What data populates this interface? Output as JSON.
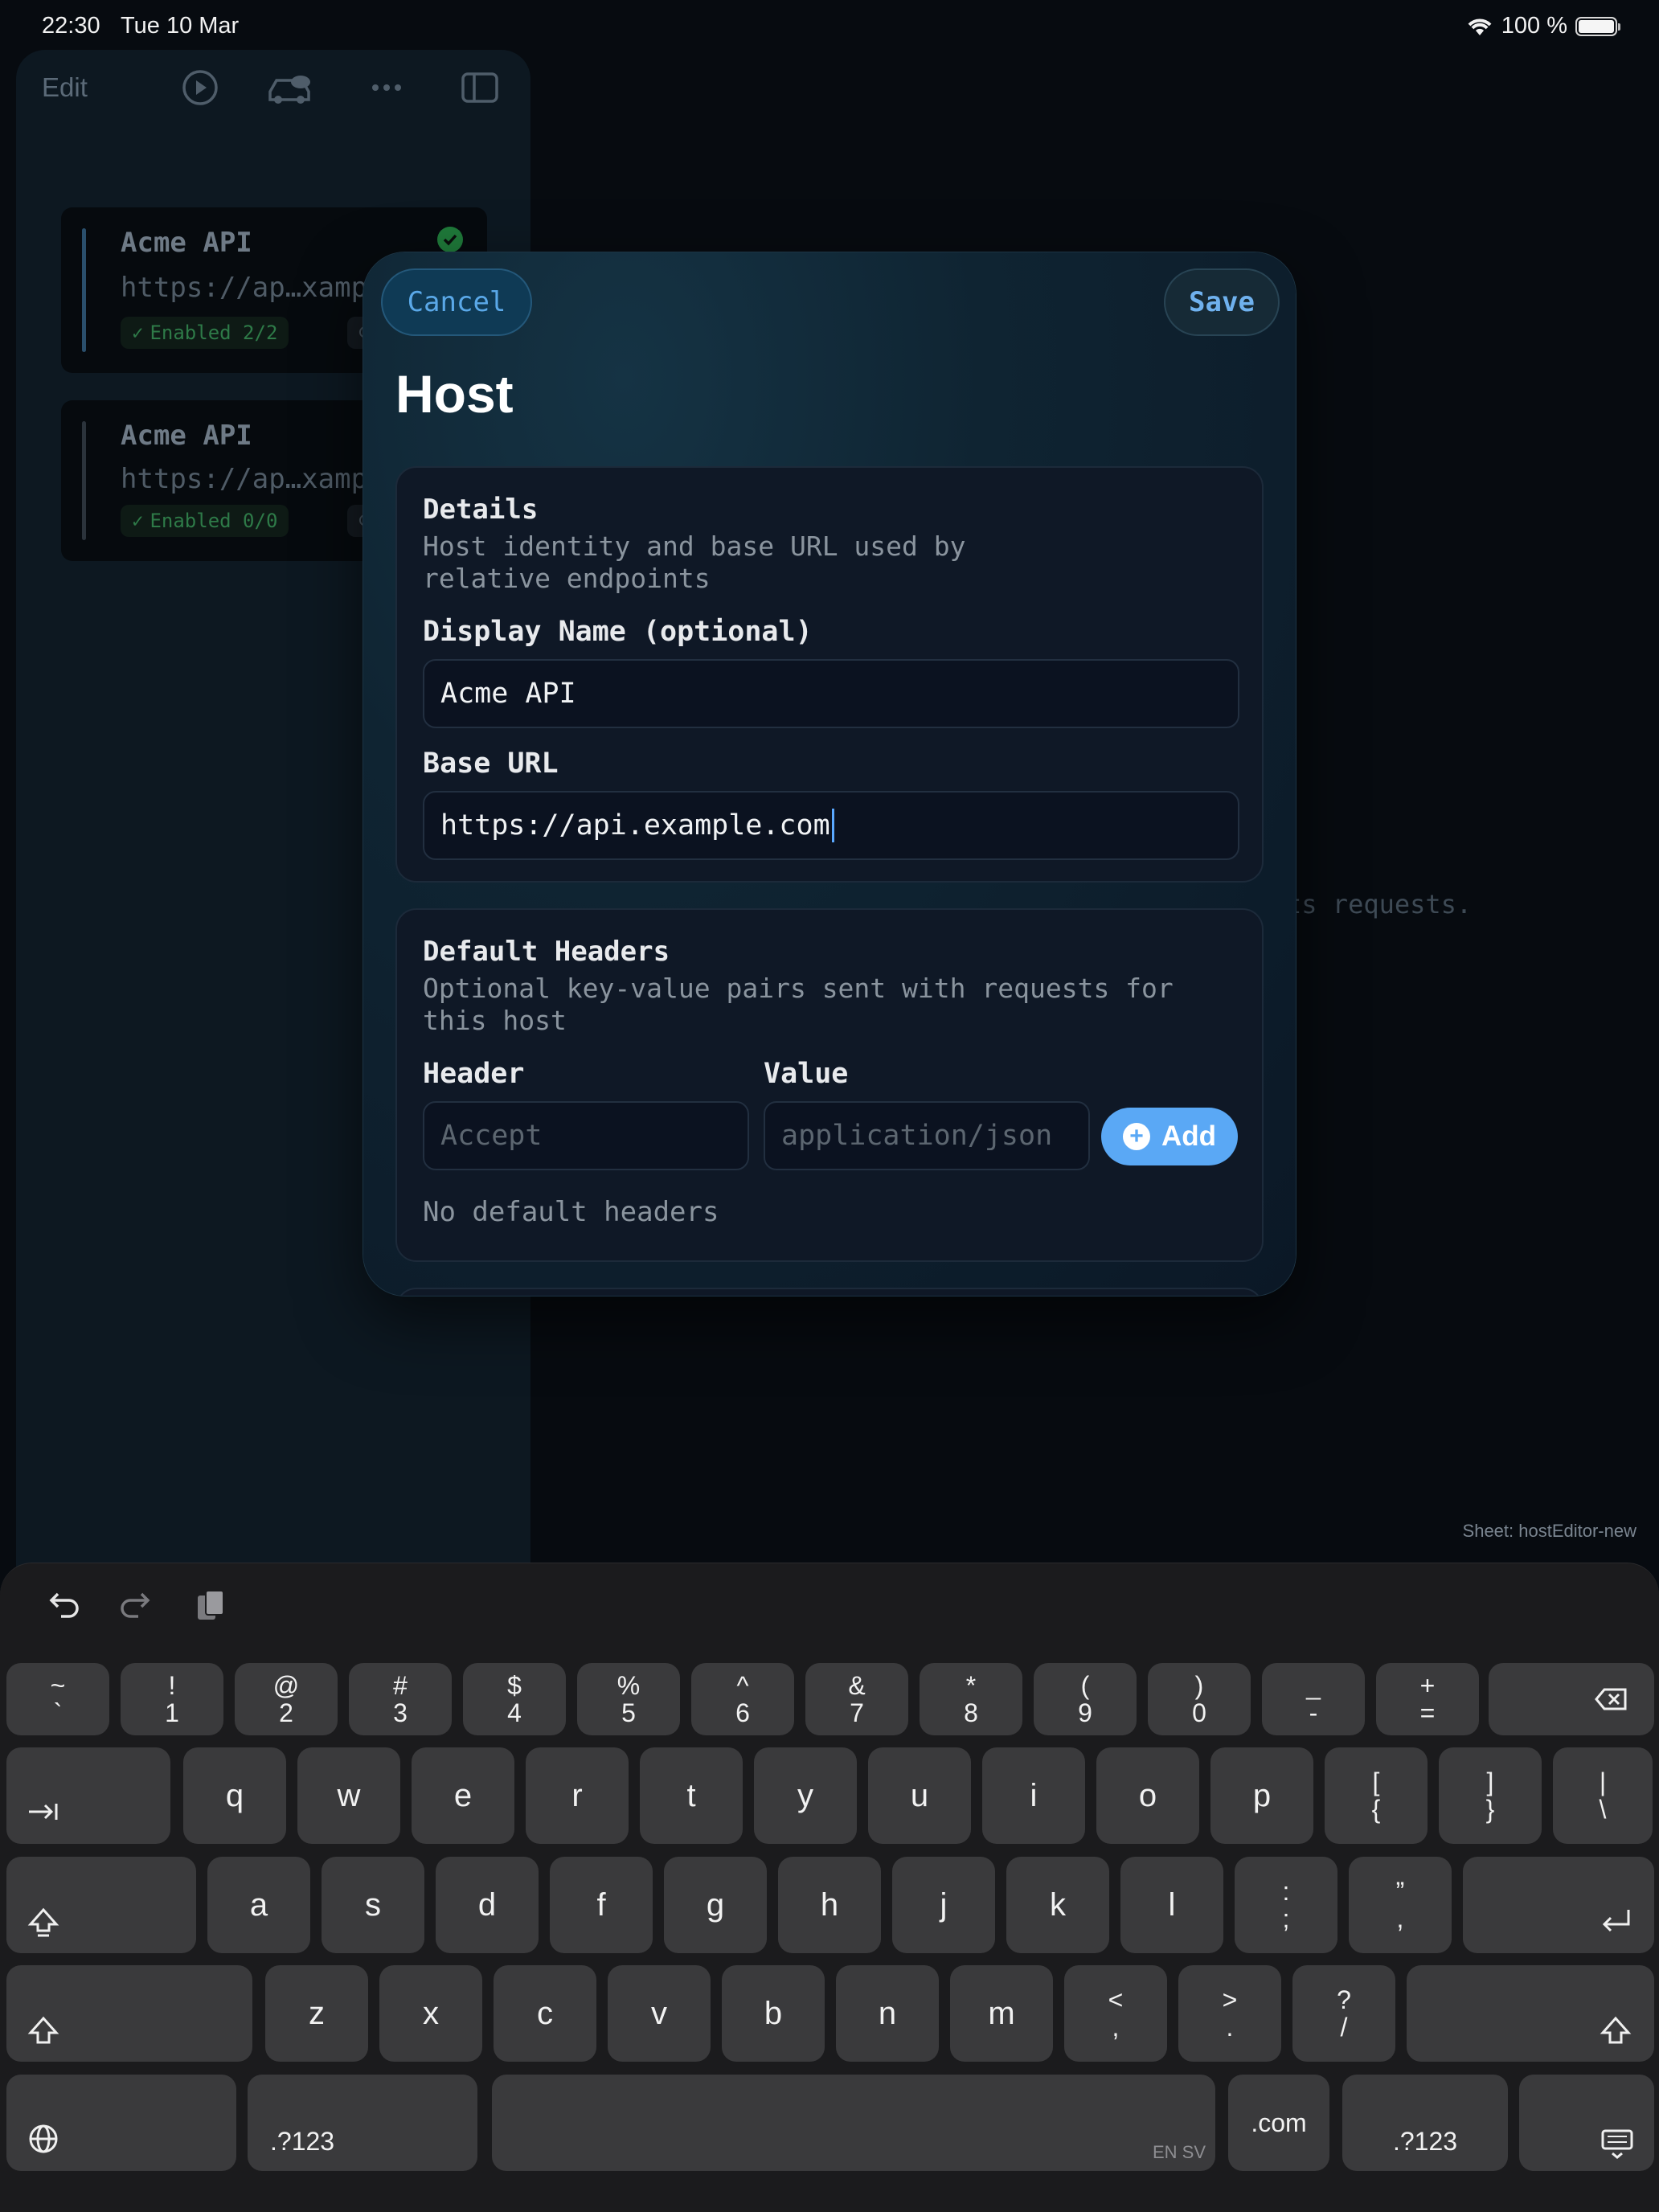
{
  "status_bar": {
    "time": "22:30",
    "date": "Tue 10 Mar",
    "battery": "100 %"
  },
  "sidebar": {
    "edit_label": "Edit",
    "hosts": [
      {
        "name": "Acme API",
        "url": "https://ap…xampl",
        "enabled": "Enabled 2/2",
        "sync": "2",
        "selected": true
      },
      {
        "name": "Acme API",
        "url": "https://ap…xampl",
        "enabled": "Enabled 0/0",
        "sync": "0",
        "selected": false
      }
    ]
  },
  "background_hint": "ts requests.",
  "sheet_label": "Sheet: hostEditor-new",
  "modal": {
    "cancel_label": "Cancel",
    "save_label": "Save",
    "title": "Host",
    "details": {
      "title": "Details",
      "description": "Host identity and base URL used by\nrelative endpoints",
      "display_name_label": "Display Name (optional)",
      "display_name_value": "Acme API",
      "base_url_label": "Base URL",
      "base_url_value": "https://api.example.com"
    },
    "headers": {
      "title": "Default Headers",
      "description": "Optional key-value pairs sent with requests for\nthis host",
      "header_label": "Header",
      "value_label": "Value",
      "header_placeholder": "Accept",
      "value_placeholder": "application/json",
      "add_label": "Add",
      "empty_text": "No default headers"
    }
  },
  "keyboard": {
    "row1": [
      [
        "~",
        "`"
      ],
      [
        "!",
        "1"
      ],
      [
        "@",
        "2"
      ],
      [
        "#",
        "3"
      ],
      [
        "$",
        "4"
      ],
      [
        "%",
        "5"
      ],
      [
        "^",
        "6"
      ],
      [
        "&",
        "7"
      ],
      [
        "*",
        "8"
      ],
      [
        "(",
        "9"
      ],
      [
        ")",
        "0"
      ],
      [
        "_",
        "-"
      ],
      [
        "+",
        "="
      ]
    ],
    "row2": [
      "q",
      "w",
      "e",
      "r",
      "t",
      "y",
      "u",
      "i",
      "o",
      "p"
    ],
    "row2_extra": [
      [
        "[",
        "{"
      ],
      [
        "]",
        "}"
      ],
      [
        "|",
        "\\"
      ]
    ],
    "row3": [
      "a",
      "s",
      "d",
      "f",
      "g",
      "h",
      "j",
      "k",
      "l"
    ],
    "row3_extra": [
      [
        ":",
        ";"
      ],
      [
        "”",
        ","
      ]
    ],
    "row4": [
      "z",
      "x",
      "c",
      "v",
      "b",
      "n",
      "m"
    ],
    "row4_extra": [
      [
        "<",
        ","
      ],
      [
        ">",
        "."
      ],
      [
        "?",
        "/"
      ]
    ],
    "numbers_label": ".?123",
    "dotcom_label": ".com",
    "space_label": "EN SV"
  }
}
